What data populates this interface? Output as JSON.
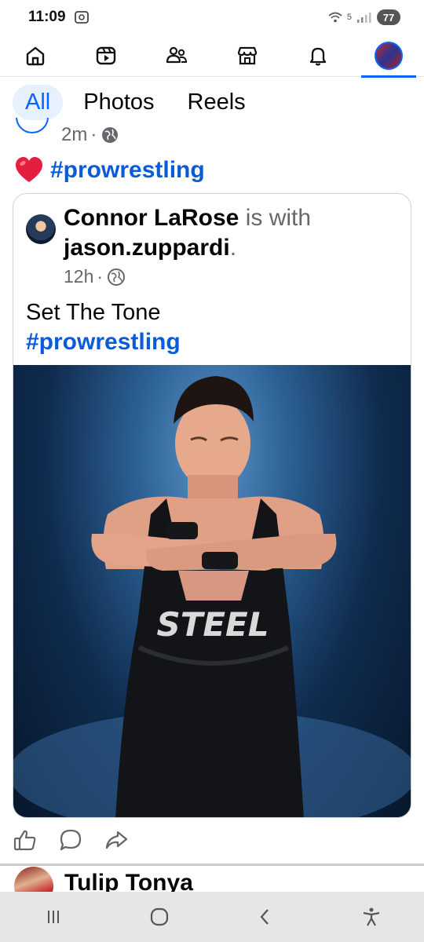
{
  "status_bar": {
    "time": "11:09",
    "network": "5",
    "battery": "77"
  },
  "top_nav": {
    "items": [
      "home-icon",
      "video-icon",
      "friends-icon",
      "marketplace-icon",
      "bell-icon",
      "profile-avatar"
    ],
    "active": "profile-avatar",
    "accent": "#0866ff"
  },
  "filter_tabs": [
    {
      "label": "All",
      "active": true
    },
    {
      "label": "Photos",
      "active": false
    },
    {
      "label": "Reels",
      "active": false
    }
  ],
  "previous_post": {
    "time": "2m",
    "separator": "·",
    "caption_hashtag": "#prowrestling"
  },
  "shared_post": {
    "author": "Connor LaRose",
    "with_text": " is with ",
    "tagged": "jason.zuppardi",
    "period": ".",
    "time": "12h",
    "separator": "·",
    "text": "Set The Tone",
    "hashtag": "#prowrestling",
    "photo_singlet_text": "STEEL"
  },
  "actions": [
    "like-icon",
    "comment-icon",
    "share-icon"
  ],
  "next_post": {
    "author": "Tulip Tonya"
  },
  "colors": {
    "link": "#0a5bd8",
    "muted": "#65676b",
    "heart": "#e41e3f"
  }
}
